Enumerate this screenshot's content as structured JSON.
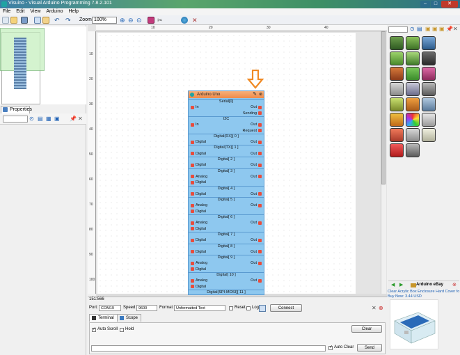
{
  "window": {
    "title": "Visuino - Visual Arduino Programming 7.8.2.101"
  },
  "menu": [
    "File",
    "Edit",
    "View",
    "Arduino",
    "Help"
  ],
  "toolbar": {
    "zoom_label": "Zoom:",
    "zoom_value": "100%"
  },
  "ruler": {
    "top": [
      "10",
      "20",
      "30",
      "40"
    ],
    "left": [
      "10",
      "20",
      "30",
      "40",
      "50",
      "60",
      "70",
      "80",
      "90",
      "100"
    ]
  },
  "properties": {
    "tab_label": "Properties"
  },
  "component": {
    "title": "Arduino Uno",
    "rows": [
      {
        "kind": "section",
        "label": "Serial[0]"
      },
      {
        "kind": "io",
        "left": "In",
        "right": "Out"
      },
      {
        "kind": "right",
        "label": "Sending"
      },
      {
        "kind": "section",
        "label": "I2C"
      },
      {
        "kind": "io",
        "left": "In",
        "right": "Out"
      },
      {
        "kind": "right",
        "label": "Request"
      },
      {
        "kind": "section",
        "label": "Digital(RX)[ 0 ]"
      },
      {
        "kind": "io",
        "left": "Digital",
        "right": "Out"
      },
      {
        "kind": "section",
        "label": "Digital(TX)[ 1 ]"
      },
      {
        "kind": "io",
        "left": "Digital",
        "right": "Out"
      },
      {
        "kind": "section",
        "label": "Digital[ 2 ]"
      },
      {
        "kind": "io",
        "left": "Digital",
        "right": "Out"
      },
      {
        "kind": "section",
        "label": "Digital[ 3 ]"
      },
      {
        "kind": "io",
        "left": "Analog",
        "right": "Out"
      },
      {
        "kind": "left",
        "label": "Digital"
      },
      {
        "kind": "section",
        "label": "Digital[ 4 ]"
      },
      {
        "kind": "io",
        "left": "Digital",
        "right": "Out"
      },
      {
        "kind": "section",
        "label": "Digital[ 5 ]"
      },
      {
        "kind": "io",
        "left": "Analog",
        "right": "Out"
      },
      {
        "kind": "left",
        "label": "Digital"
      },
      {
        "kind": "section",
        "label": "Digital[ 6 ]"
      },
      {
        "kind": "io",
        "left": "Analog",
        "right": "Out"
      },
      {
        "kind": "left",
        "label": "Digital"
      },
      {
        "kind": "section",
        "label": "Digital[ 7 ]"
      },
      {
        "kind": "io",
        "left": "Digital",
        "right": "Out"
      },
      {
        "kind": "section",
        "label": "Digital[ 8 ]"
      },
      {
        "kind": "io",
        "left": "Digital",
        "right": "Out"
      },
      {
        "kind": "section",
        "label": "Digital[ 9 ]"
      },
      {
        "kind": "io",
        "left": "Analog",
        "right": "Out"
      },
      {
        "kind": "left",
        "label": "Digital"
      },
      {
        "kind": "section",
        "label": "Digital[ 10 ]"
      },
      {
        "kind": "io",
        "left": "Analog",
        "right": "Out"
      },
      {
        "kind": "left",
        "label": "Digital"
      },
      {
        "kind": "section",
        "label": "Digital(SPI-MOSI)[ 11 ]"
      }
    ]
  },
  "status": {
    "coords": "151:566"
  },
  "serial": {
    "port_label": "Port:",
    "port_value": "COM19",
    "speed_label": "Speed:",
    "speed_value": "9600",
    "format_label": "Format:",
    "format_value": "Unformatted Text",
    "reset_label": "Reset",
    "log_label": "Log",
    "connect_label": "Connect",
    "tab_terminal": "Terminal",
    "tab_scope": "Scope",
    "auto_scroll_label": "Auto Scroll",
    "hold_label": "Hold",
    "clear_label": "Clear",
    "auto_clear_label": "Auto Clear",
    "send_label": "Send"
  },
  "ebay": {
    "title": "Arduino eBay",
    "item_text": "Clear Acrylic Box Enclosure Hard Cover fo",
    "price_text": "Buy Now: 3.44 USD"
  },
  "colors": {
    "component_body": "#8ec8ef",
    "component_header": "#ef8a4a",
    "arrow": "#f08a24"
  }
}
